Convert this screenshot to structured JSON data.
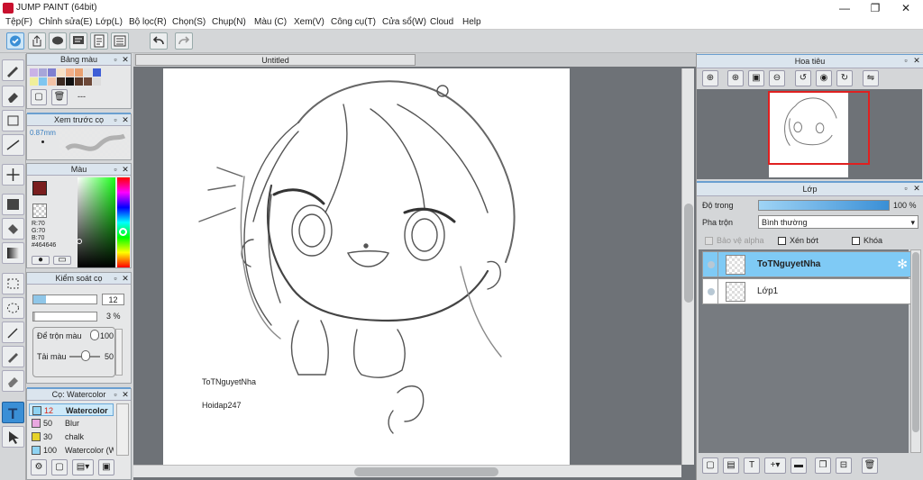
{
  "window": {
    "title": "JUMP PAINT (64bit)",
    "minimize": "—",
    "restore": "❐",
    "close": "✕"
  },
  "menu": [
    "Tệp(F)",
    "Chỉnh sửa(E)",
    "Lớp(L)",
    "Bộ lọc(R)",
    "Chọn(S)",
    "Chụp(N)",
    "Màu (C)",
    "Xem(V)",
    "Công cụ(T)",
    "Cửa sổ(W)",
    "Cloud",
    "Help"
  ],
  "document_tab": "Untitled",
  "palette_panel": {
    "title": "Bảng màu",
    "dash": "---"
  },
  "brush_preview_panel": {
    "title": "Xem trước cọ",
    "size": "0.87mm"
  },
  "color_panel": {
    "title": "Màu",
    "r": "R:70",
    "g": "G:70",
    "b": "B:70",
    "hex": "#464646",
    "current_color": "#7a1e1e"
  },
  "brush_control": {
    "title": "Kiểm soát cọ",
    "size": "12",
    "opacity": "3 %",
    "blend_label": "Để trộn màu",
    "blend_value": "100",
    "reload_label": "Tải màu",
    "reload_value": "50"
  },
  "brush_list": {
    "title": "Cọ: Watercolor",
    "items": [
      {
        "size": "12",
        "name": "Watercolor",
        "color": "#8fd3f2",
        "selected": true
      },
      {
        "size": "50",
        "name": "Blur",
        "color": "#e9a7e0",
        "selected": false
      },
      {
        "size": "30",
        "name": "chalk",
        "color": "#e6d22a",
        "selected": false
      },
      {
        "size": "100",
        "name": "Watercolor (W",
        "color": "#8fd3f2",
        "selected": false
      }
    ]
  },
  "canvas_text": {
    "line1": "ToTNguyetNha",
    "line2": "Hoidap247"
  },
  "navigator": {
    "title": "Hoa tiêu"
  },
  "layer_panel": {
    "title": "Lớp",
    "opacity_label": "Độ trong",
    "opacity_value": "100 %",
    "opacity": 1.0,
    "blend_label": "Pha trộn",
    "blend_value": "Bình thường",
    "protect_alpha": "Bảo vệ alpha",
    "clipping": "Xén bớt",
    "lock": "Khóa",
    "layers": [
      {
        "name": "ToTNguyetNha",
        "selected": true
      },
      {
        "name": "Lớp1",
        "selected": false
      }
    ]
  },
  "accent_color": "#3a8fd6",
  "selection_color": "#7fcaf5"
}
